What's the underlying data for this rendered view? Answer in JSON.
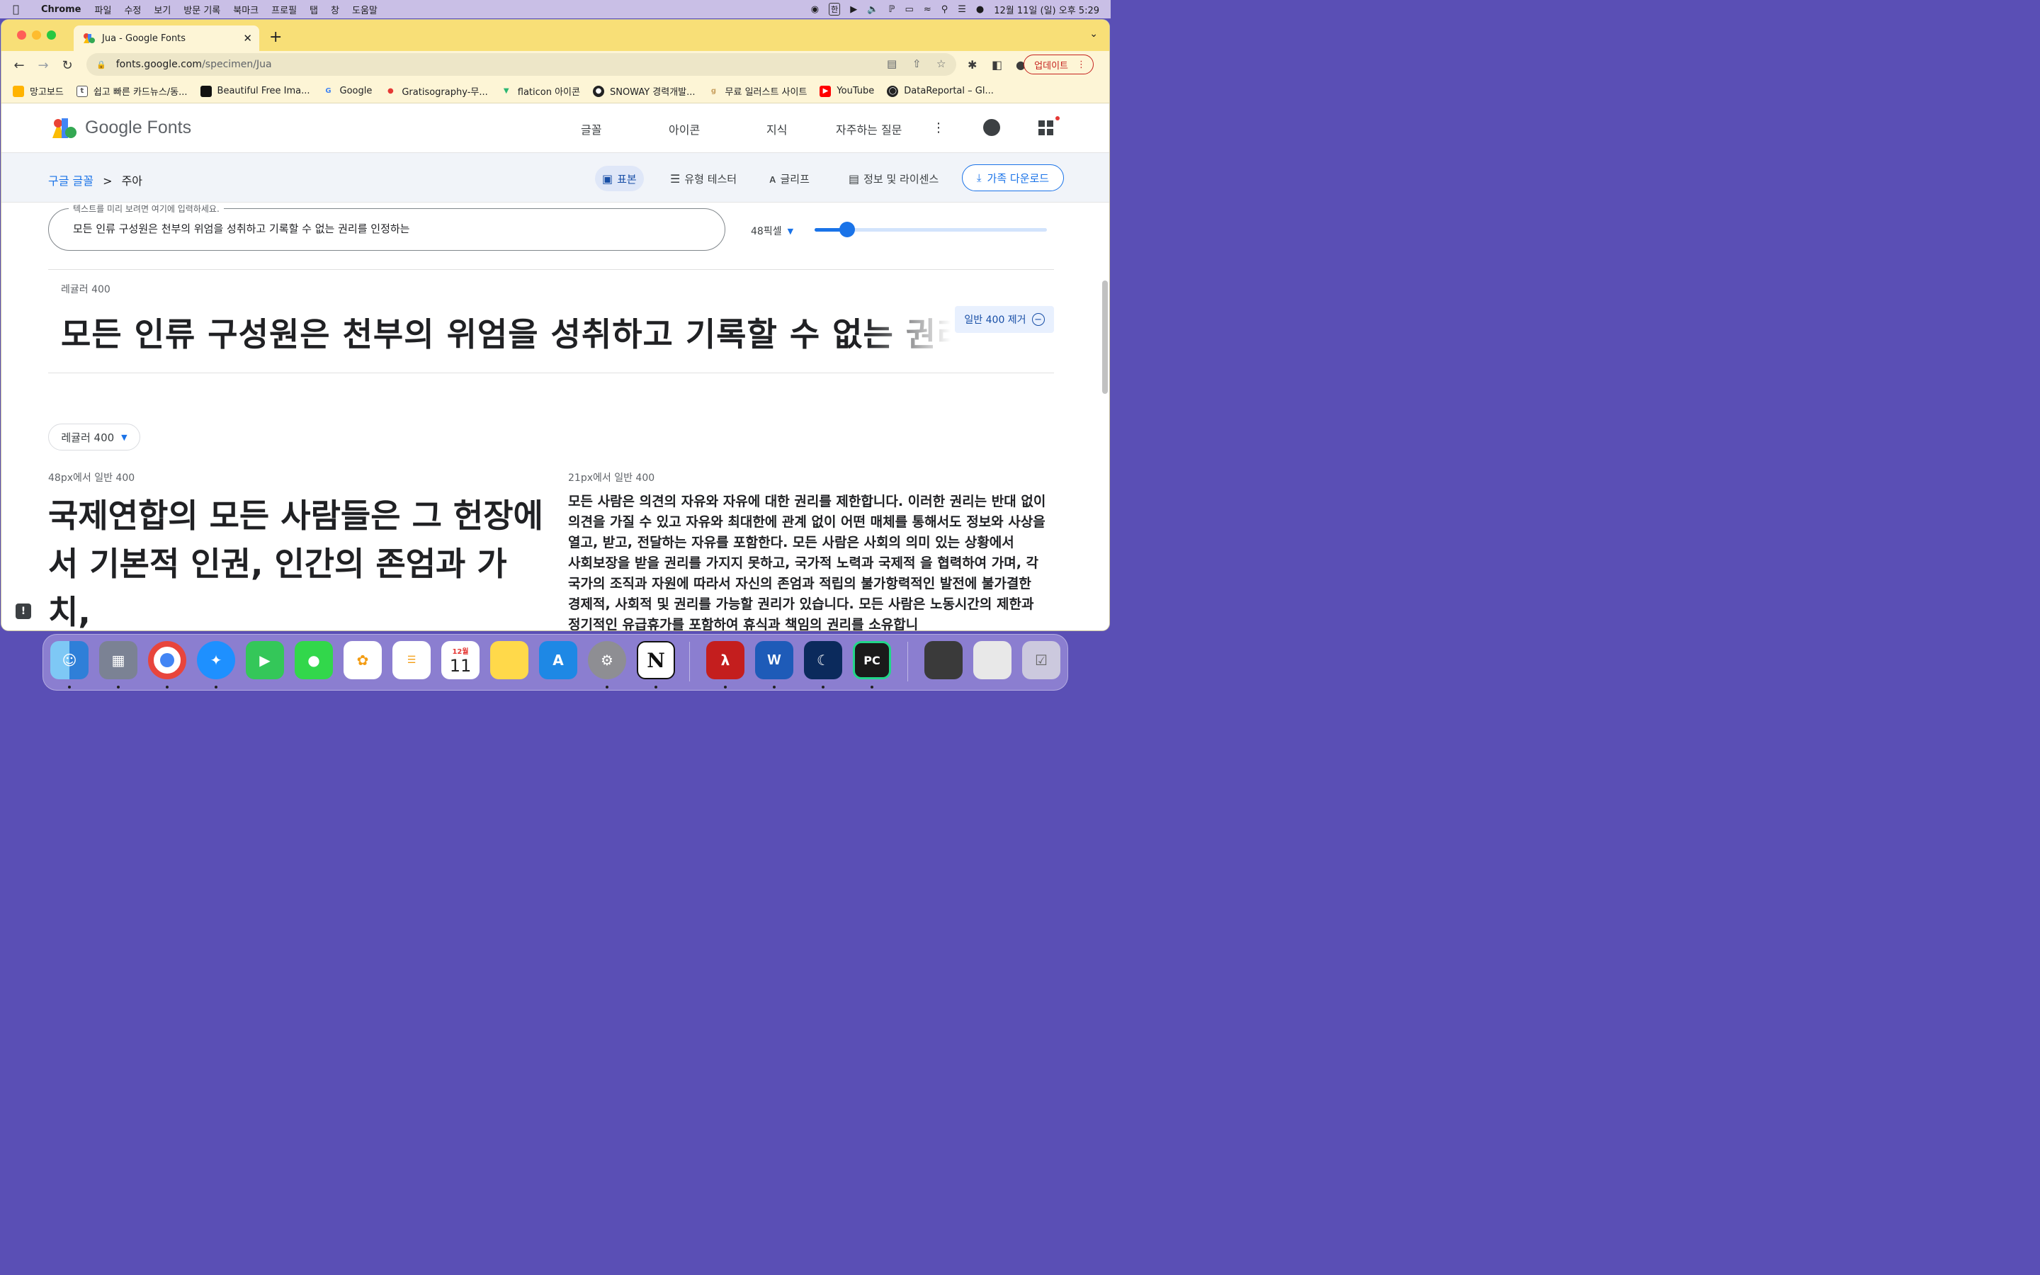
{
  "menubar": {
    "app_name": "Chrome",
    "items": [
      "파일",
      "수정",
      "보기",
      "방문 기록",
      "북마크",
      "프로필",
      "탭",
      "창",
      "도움말"
    ],
    "ime": "한",
    "clock": "12월 11일 (일) 오후 5:29"
  },
  "browser": {
    "tab_title": "Jua - Google Fonts",
    "url_domain": "fonts.google.com",
    "url_path": "/specimen/Jua",
    "update_label": "업데이트",
    "bookmarks": [
      "망고보드",
      "쉽고 빠른 카드뉴스/동...",
      "Beautiful Free Ima...",
      "Google",
      "Gratisography-무...",
      "flaticon 아이콘",
      "SNOWAY 경력개발...",
      "무료 일러스트 사이트",
      "YouTube",
      "DataReportal – Gl..."
    ]
  },
  "gf": {
    "logo_text": "Google Fonts",
    "nav": [
      "글꼴",
      "아이콘",
      "지식",
      "자주하는 질문"
    ],
    "breadcrumb_root": "구글 글꼴",
    "breadcrumb_sep": ">",
    "breadcrumb_current": "주아",
    "tabs": [
      "표본",
      "유형 테스터",
      "글리프",
      "정보 및 라이센스"
    ],
    "download_label": "가족 다운로드"
  },
  "preview": {
    "legend": "텍스트를 미리 보려면 여기에 입력하세요.",
    "value": "모든 인류 구성원은 천부의 위엄을 성취하고 기록할 수 없는 권리를 인정하는",
    "size_label": "48픽셀",
    "size_level": 0.14
  },
  "style_row": {
    "label": "레귤러 400",
    "sample": "모든 인류 구성원은 천부의 위엄을 성취하고 기록할 수 없는 권리를 인정하는",
    "remove_label": "일반 400 제거"
  },
  "weight_dropdown": "레귤러 400",
  "left_col": {
    "label": "48px에서 일반 400",
    "text": "국제연합의 모든 사람들은 그 헌장에서 기본적 인권, 인간의 존엄과 가치,"
  },
  "right_col": {
    "label": "21px에서 일반 400",
    "text": "모든 사람은 의견의 자유와 자유에 대한 권리를 제한합니다. 이러한 권리는 반대 없이 의견을 가질 수 있고 자유와 최대한에 관계 없이 어떤 매체를 통해서도 정보와 사상을 열고, 받고, 전달하는 자유를 포함한다. 모든 사람은 사회의 의미 있는 상황에서 사회보장을 받을 권리를 가지지 못하고, 국가적 노력과 국제적 을 협력하여 가며, 각 국가의 조직과 자원에 따라서 자신의 존엄과 적립의 불가항력적인 발전에 불가결한 경제적, 사회적 및 권리를 가능할 권리가 있습니다. 모든 사람은 노동시간의 제한과 정기적인 유급휴가를 포함하여 휴식과 책임의 권리를 소유합니"
  },
  "dock": {
    "calendar_month": "12월",
    "calendar_day": "11"
  }
}
